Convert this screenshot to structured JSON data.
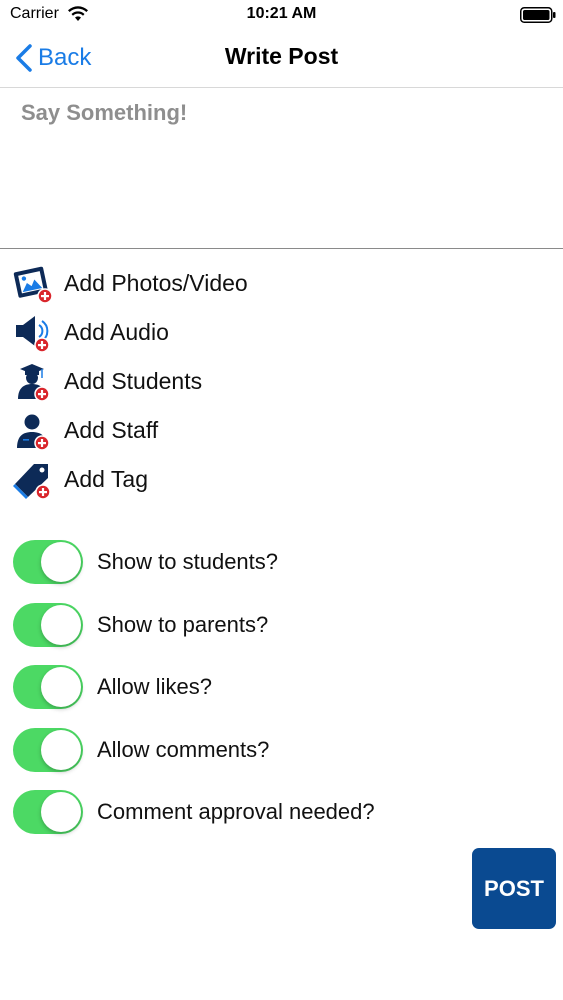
{
  "status_bar": {
    "carrier": "Carrier",
    "time": "10:21 AM"
  },
  "nav": {
    "back_label": "Back",
    "title": "Write Post"
  },
  "composer": {
    "placeholder": "Say Something!",
    "value": ""
  },
  "add_items": [
    {
      "label": "Add Photos/Video",
      "icon": "add-photo-video-icon"
    },
    {
      "label": "Add Audio",
      "icon": "add-audio-icon"
    },
    {
      "label": "Add Students",
      "icon": "add-students-icon"
    },
    {
      "label": "Add Staff",
      "icon": "add-staff-icon"
    },
    {
      "label": "Add Tag",
      "icon": "add-tag-icon"
    }
  ],
  "toggles": [
    {
      "label": "Show to students?",
      "on": true
    },
    {
      "label": "Show to parents?",
      "on": true
    },
    {
      "label": "Allow likes?",
      "on": true
    },
    {
      "label": "Allow comments?",
      "on": true
    },
    {
      "label": "Comment approval needed?",
      "on": true
    }
  ],
  "post_button": {
    "label": "POST"
  },
  "colors": {
    "accent_blue": "#1a7ce6",
    "icon_navy": "#0d2a57",
    "badge_red": "#d9262c",
    "switch_on": "#4cd964",
    "post_button": "#0a4a91"
  }
}
